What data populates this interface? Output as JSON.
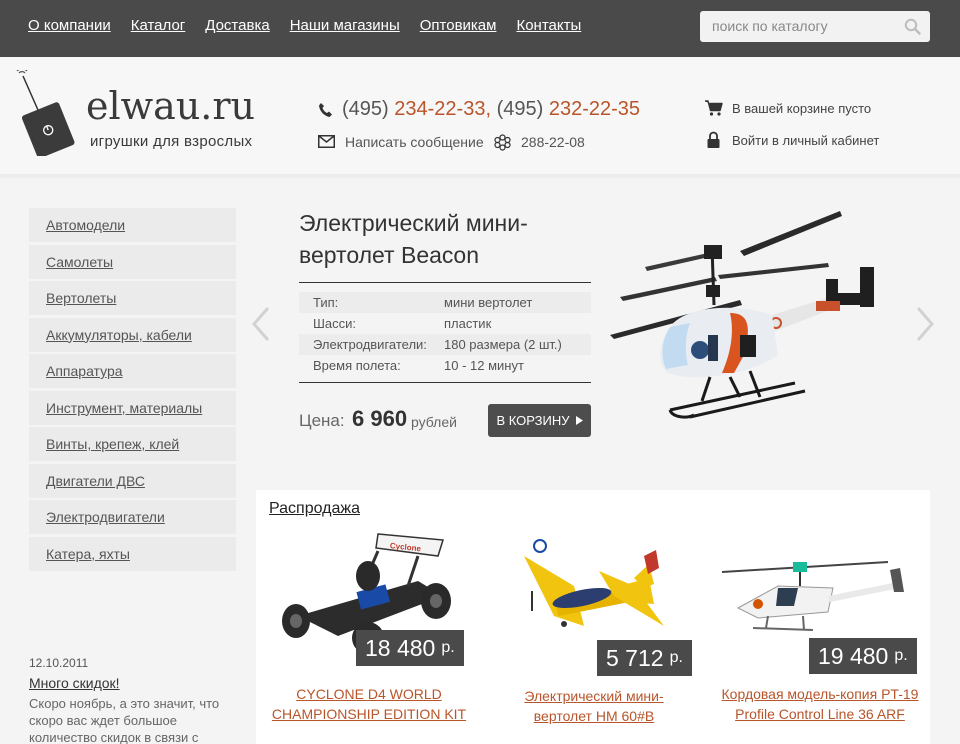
{
  "nav": {
    "items": [
      "О компании",
      "Каталог",
      "Доставка",
      "Наши магазины",
      "Оптовикам",
      "Контакты"
    ],
    "search_placeholder": "поиск по каталогу"
  },
  "header": {
    "logo": "elwau.ru",
    "tagline": "игрушки для взрослых",
    "phone_prefix_1": "(495)",
    "phone_1": "234-22-33,",
    "phone_prefix_2": "(495)",
    "phone_2": "232-22-35",
    "message_link": "Написать сообщение",
    "icq": "288-22-08",
    "cart": "В вашей корзине пусто",
    "login": "Войти в личный кабинет"
  },
  "sidebar": {
    "items": [
      "Автомодели",
      "Самолеты",
      "Вертолеты",
      "Аккумуляторы, кабели",
      "Аппаратура",
      "Инструмент, материалы",
      "Винты, крепеж, клей",
      "Двигатели ДВС",
      "Электродвигатели",
      "Катера, яхты"
    ]
  },
  "news": {
    "date": "12.10.2011",
    "title": "Много скидок!",
    "text": "Скоро ноябрь, а это значит, что скоро вас ждет большое количество скидок в связи с"
  },
  "featured": {
    "title": "Электрический мини-вертолет Beacon",
    "specs": [
      {
        "k": "Тип:",
        "v": "мини вертолет"
      },
      {
        "k": "Шасси:",
        "v": "пластик"
      },
      {
        "k": "Электродвигатели:",
        "v": "180 размера (2 шт.)"
      },
      {
        "k": "Время полета:",
        "v": "10 - 12 минут"
      }
    ],
    "price_label": "Цена:",
    "price": "6 960",
    "currency": "рублей",
    "buy_label": "В КОРЗИНУ",
    "colors": {
      "accent": "#b8552a",
      "dark": "#4a4a4a"
    }
  },
  "sale": {
    "title": "Распродажа",
    "items": [
      {
        "price": "18 480",
        "unit": "р.",
        "name": "CYCLONE D4 WORLD CHAMPIONSHIP EDITION KIT"
      },
      {
        "price": "5 712",
        "unit": "р.",
        "name": "Электрический мини-вертолет HM 60#B"
      },
      {
        "price": "19 480",
        "unit": "р.",
        "name": "Кордовая модель-копия PT-19 Profile Control Line 36 ARF"
      }
    ]
  }
}
